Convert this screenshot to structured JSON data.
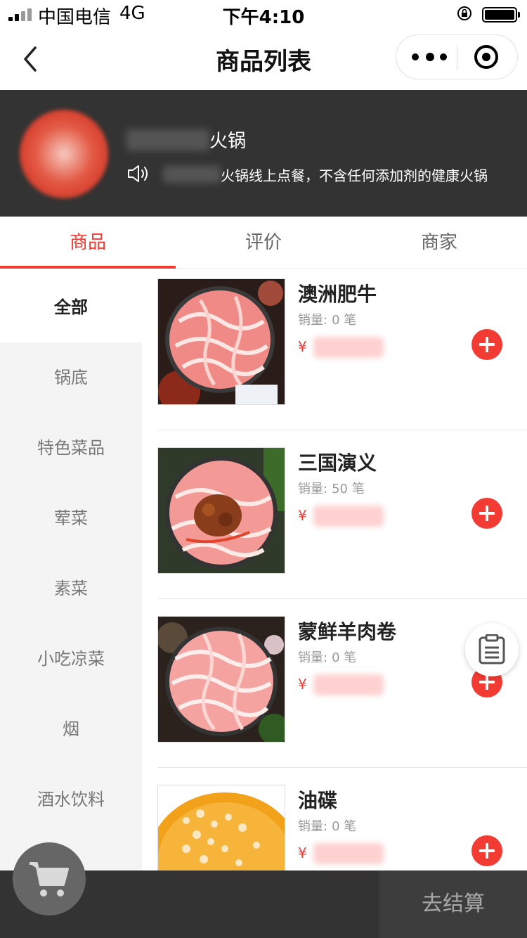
{
  "status_bar": {
    "carrier": "中国电信",
    "network": "4G",
    "time": "下午4:10"
  },
  "nav": {
    "title": "商品列表"
  },
  "shop": {
    "name": "火锅",
    "notice": "火锅线上点餐，不含任何添加剂的健康火锅"
  },
  "tabs": [
    {
      "label": "商品",
      "active": true
    },
    {
      "label": "评价",
      "active": false
    },
    {
      "label": "商家",
      "active": false
    }
  ],
  "categories": [
    {
      "label": "全部",
      "active": true
    },
    {
      "label": "锅底"
    },
    {
      "label": "特色菜品"
    },
    {
      "label": "荤菜"
    },
    {
      "label": "素菜"
    },
    {
      "label": "小吃凉菜"
    },
    {
      "label": "烟"
    },
    {
      "label": "酒水饮料"
    }
  ],
  "products": [
    {
      "name": "澳洲肥牛",
      "sales_label": "销量:",
      "sales": "0 笔",
      "currency": "¥"
    },
    {
      "name": "三国演义",
      "sales_label": "销量:",
      "sales": "50 笔",
      "currency": "¥"
    },
    {
      "name": "蒙鲜羊肉卷",
      "sales_label": "销量:",
      "sales": "0 笔",
      "currency": "¥"
    },
    {
      "name": "油碟",
      "sales_label": "销量:",
      "sales": "0 笔",
      "currency": "¥"
    }
  ],
  "bottom": {
    "checkout_label": "去结算"
  },
  "colors": {
    "accent": "#f23b33",
    "header_bg": "#333333",
    "sidebar_bg": "#f4f4f4"
  }
}
